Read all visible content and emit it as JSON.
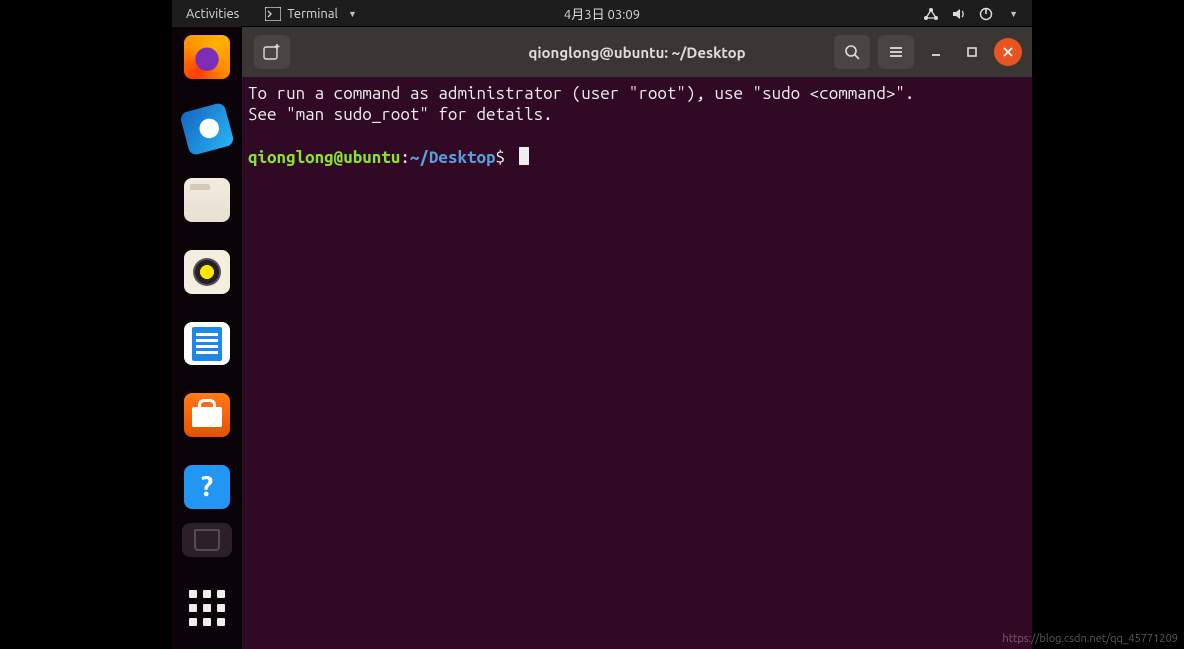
{
  "topbar": {
    "activities": "Activities",
    "app": "Terminal",
    "clock": "4月3日 03:09"
  },
  "dock": {
    "items": [
      "Firefox",
      "Thunderbird",
      "Files",
      "Rhythmbox",
      "LibreOffice Writer",
      "Ubuntu Software",
      "Help",
      "Trash"
    ]
  },
  "window": {
    "title": "qionglong@ubuntu: ~/Desktop"
  },
  "terminal": {
    "motd_line1": "To run a command as administrator (user \"root\"), use \"sudo <command>\".",
    "motd_line2": "See \"man sudo_root\" for details.",
    "prompt_user": "qionglong@ubuntu",
    "prompt_sep": ":",
    "prompt_path": "~/Desktop",
    "prompt_symbol": "$"
  },
  "watermark": "https://blog.csdn.net/qq_45771209"
}
